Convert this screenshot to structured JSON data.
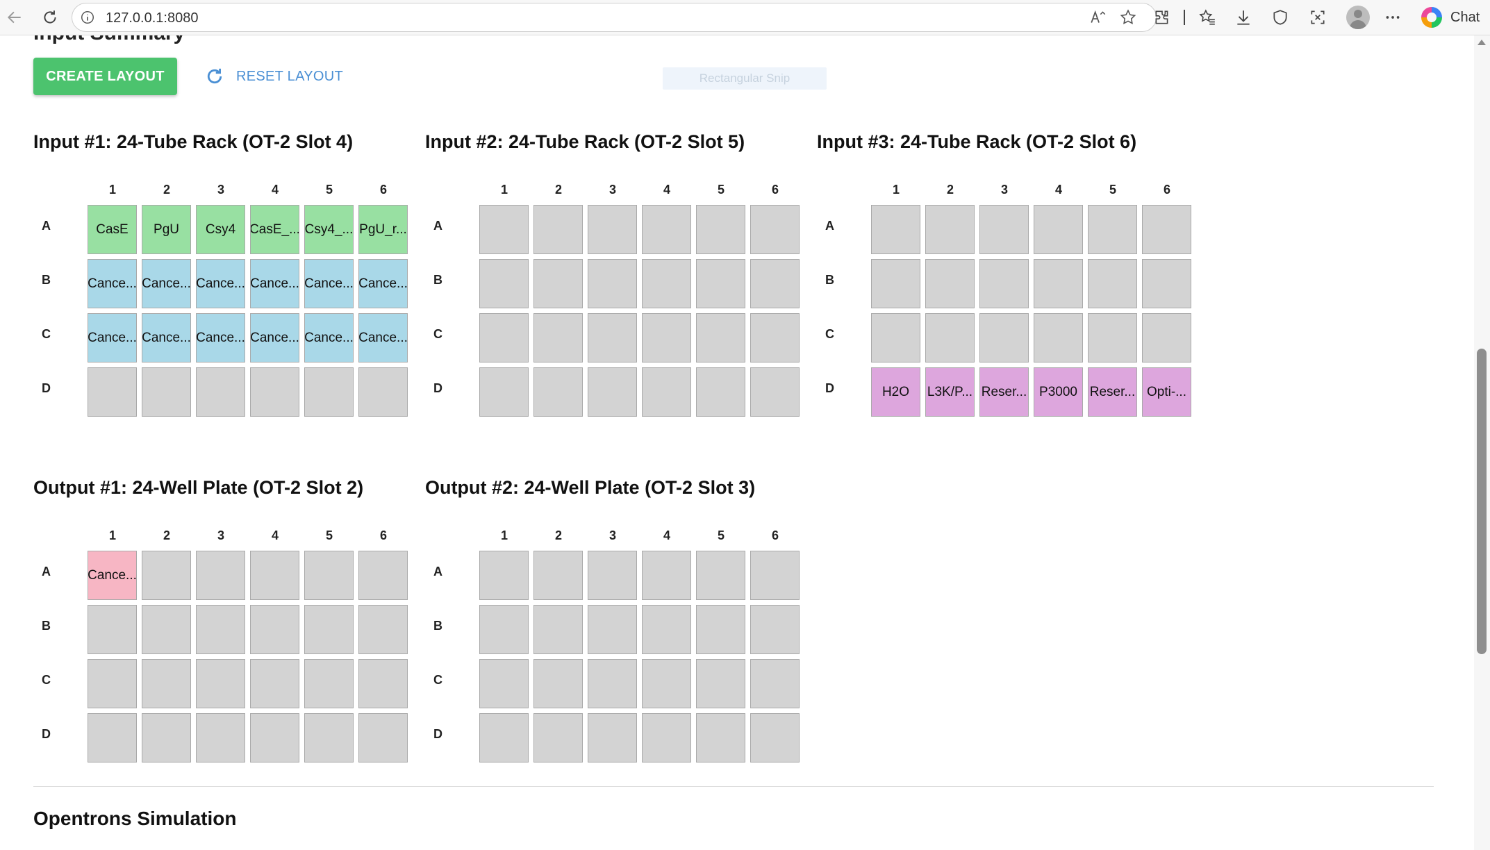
{
  "browser": {
    "url": "127.0.0.1:8080",
    "chat_label": "Chat",
    "icons": [
      "back-icon",
      "refresh-icon",
      "info-icon",
      "read-aloud-icon",
      "favorite-star-icon",
      "extensions-icon",
      "favorites-icon",
      "downloads-icon",
      "shield-icon",
      "screenshot-icon",
      "profile-avatar",
      "more-icon",
      "copilot-icon"
    ]
  },
  "page": {
    "cut_heading": "Input Summary",
    "create_label": "CREATE LAYOUT",
    "reset_label": "RESET LAYOUT",
    "snip_label": "Rectangular Snip",
    "sim_title": "Opentrons Simulation"
  },
  "columns": [
    "1",
    "2",
    "3",
    "4",
    "5",
    "6"
  ],
  "rows": [
    "A",
    "B",
    "C",
    "D"
  ],
  "colors": {
    "green": "#98e0a2",
    "blue": "#a9d8e8",
    "purple": "#dda6dd",
    "pink": "#f7b6c4",
    "empty": "#d3d3d3",
    "button_green": "#4cc36e",
    "link_blue": "#4a8fd4"
  },
  "racks": [
    {
      "id": "input-1",
      "title": "Input #1: 24-Tube Rack (OT-2 Slot 4)",
      "wells": [
        [
          {
            "t": "CasE",
            "c": "green"
          },
          {
            "t": "PgU",
            "c": "green"
          },
          {
            "t": "Csy4",
            "c": "green"
          },
          {
            "t": "CasE_...",
            "c": "green"
          },
          {
            "t": "Csy4_...",
            "c": "green"
          },
          {
            "t": "PgU_r...",
            "c": "green"
          }
        ],
        [
          {
            "t": "Cance...",
            "c": "blue"
          },
          {
            "t": "Cance...",
            "c": "blue"
          },
          {
            "t": "Cance...",
            "c": "blue"
          },
          {
            "t": "Cance...",
            "c": "blue"
          },
          {
            "t": "Cance...",
            "c": "blue"
          },
          {
            "t": "Cance...",
            "c": "blue"
          }
        ],
        [
          {
            "t": "Cance...",
            "c": "blue"
          },
          {
            "t": "Cance...",
            "c": "blue"
          },
          {
            "t": "Cance...",
            "c": "blue"
          },
          {
            "t": "Cance...",
            "c": "blue"
          },
          {
            "t": "Cance...",
            "c": "blue"
          },
          {
            "t": "Cance...",
            "c": "blue"
          }
        ],
        [
          {
            "t": "",
            "c": "empty"
          },
          {
            "t": "",
            "c": "empty"
          },
          {
            "t": "",
            "c": "empty"
          },
          {
            "t": "",
            "c": "empty"
          },
          {
            "t": "",
            "c": "empty"
          },
          {
            "t": "",
            "c": "empty"
          }
        ]
      ]
    },
    {
      "id": "input-2",
      "title": "Input #2: 24-Tube Rack (OT-2 Slot 5)",
      "wells": [
        [
          {
            "t": "",
            "c": "empty"
          },
          {
            "t": "",
            "c": "empty"
          },
          {
            "t": "",
            "c": "empty"
          },
          {
            "t": "",
            "c": "empty"
          },
          {
            "t": "",
            "c": "empty"
          },
          {
            "t": "",
            "c": "empty"
          }
        ],
        [
          {
            "t": "",
            "c": "empty"
          },
          {
            "t": "",
            "c": "empty"
          },
          {
            "t": "",
            "c": "empty"
          },
          {
            "t": "",
            "c": "empty"
          },
          {
            "t": "",
            "c": "empty"
          },
          {
            "t": "",
            "c": "empty"
          }
        ],
        [
          {
            "t": "",
            "c": "empty"
          },
          {
            "t": "",
            "c": "empty"
          },
          {
            "t": "",
            "c": "empty"
          },
          {
            "t": "",
            "c": "empty"
          },
          {
            "t": "",
            "c": "empty"
          },
          {
            "t": "",
            "c": "empty"
          }
        ],
        [
          {
            "t": "",
            "c": "empty"
          },
          {
            "t": "",
            "c": "empty"
          },
          {
            "t": "",
            "c": "empty"
          },
          {
            "t": "",
            "c": "empty"
          },
          {
            "t": "",
            "c": "empty"
          },
          {
            "t": "",
            "c": "empty"
          }
        ]
      ]
    },
    {
      "id": "input-3",
      "title": "Input #3: 24-Tube Rack (OT-2 Slot 6)",
      "wells": [
        [
          {
            "t": "",
            "c": "empty"
          },
          {
            "t": "",
            "c": "empty"
          },
          {
            "t": "",
            "c": "empty"
          },
          {
            "t": "",
            "c": "empty"
          },
          {
            "t": "",
            "c": "empty"
          },
          {
            "t": "",
            "c": "empty"
          }
        ],
        [
          {
            "t": "",
            "c": "empty"
          },
          {
            "t": "",
            "c": "empty"
          },
          {
            "t": "",
            "c": "empty"
          },
          {
            "t": "",
            "c": "empty"
          },
          {
            "t": "",
            "c": "empty"
          },
          {
            "t": "",
            "c": "empty"
          }
        ],
        [
          {
            "t": "",
            "c": "empty"
          },
          {
            "t": "",
            "c": "empty"
          },
          {
            "t": "",
            "c": "empty"
          },
          {
            "t": "",
            "c": "empty"
          },
          {
            "t": "",
            "c": "empty"
          },
          {
            "t": "",
            "c": "empty"
          }
        ],
        [
          {
            "t": "H2O",
            "c": "purple"
          },
          {
            "t": "L3K/P...",
            "c": "purple"
          },
          {
            "t": "Reser...",
            "c": "purple"
          },
          {
            "t": "P3000",
            "c": "purple"
          },
          {
            "t": "Reser...",
            "c": "purple"
          },
          {
            "t": "Opti-...",
            "c": "purple"
          }
        ]
      ]
    },
    {
      "id": "output-1",
      "title": "Output #1: 24-Well Plate (OT-2 Slot 2)",
      "wells": [
        [
          {
            "t": "Cance...",
            "c": "pink"
          },
          {
            "t": "",
            "c": "empty"
          },
          {
            "t": "",
            "c": "empty"
          },
          {
            "t": "",
            "c": "empty"
          },
          {
            "t": "",
            "c": "empty"
          },
          {
            "t": "",
            "c": "empty"
          }
        ],
        [
          {
            "t": "",
            "c": "empty"
          },
          {
            "t": "",
            "c": "empty"
          },
          {
            "t": "",
            "c": "empty"
          },
          {
            "t": "",
            "c": "empty"
          },
          {
            "t": "",
            "c": "empty"
          },
          {
            "t": "",
            "c": "empty"
          }
        ],
        [
          {
            "t": "",
            "c": "empty"
          },
          {
            "t": "",
            "c": "empty"
          },
          {
            "t": "",
            "c": "empty"
          },
          {
            "t": "",
            "c": "empty"
          },
          {
            "t": "",
            "c": "empty"
          },
          {
            "t": "",
            "c": "empty"
          }
        ],
        [
          {
            "t": "",
            "c": "empty"
          },
          {
            "t": "",
            "c": "empty"
          },
          {
            "t": "",
            "c": "empty"
          },
          {
            "t": "",
            "c": "empty"
          },
          {
            "t": "",
            "c": "empty"
          },
          {
            "t": "",
            "c": "empty"
          }
        ]
      ]
    },
    {
      "id": "output-2",
      "title": "Output #2: 24-Well Plate (OT-2 Slot 3)",
      "wells": [
        [
          {
            "t": "",
            "c": "empty"
          },
          {
            "t": "",
            "c": "empty"
          },
          {
            "t": "",
            "c": "empty"
          },
          {
            "t": "",
            "c": "empty"
          },
          {
            "t": "",
            "c": "empty"
          },
          {
            "t": "",
            "c": "empty"
          }
        ],
        [
          {
            "t": "",
            "c": "empty"
          },
          {
            "t": "",
            "c": "empty"
          },
          {
            "t": "",
            "c": "empty"
          },
          {
            "t": "",
            "c": "empty"
          },
          {
            "t": "",
            "c": "empty"
          },
          {
            "t": "",
            "c": "empty"
          }
        ],
        [
          {
            "t": "",
            "c": "empty"
          },
          {
            "t": "",
            "c": "empty"
          },
          {
            "t": "",
            "c": "empty"
          },
          {
            "t": "",
            "c": "empty"
          },
          {
            "t": "",
            "c": "empty"
          },
          {
            "t": "",
            "c": "empty"
          }
        ],
        [
          {
            "t": "",
            "c": "empty"
          },
          {
            "t": "",
            "c": "empty"
          },
          {
            "t": "",
            "c": "empty"
          },
          {
            "t": "",
            "c": "empty"
          },
          {
            "t": "",
            "c": "empty"
          },
          {
            "t": "",
            "c": "empty"
          }
        ]
      ]
    }
  ]
}
